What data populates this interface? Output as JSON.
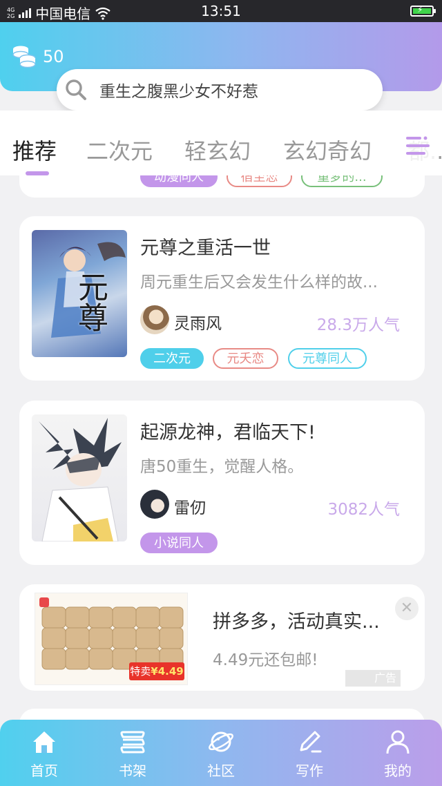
{
  "status_bar": {
    "network": "4G",
    "network2": "2G",
    "carrier": "中国电信",
    "time": "13:51"
  },
  "header": {
    "coin_count": "50",
    "search_placeholder": "重生之腹黑少女不好惹"
  },
  "tabs": [
    {
      "label": "推荐",
      "active": true
    },
    {
      "label": "二次元"
    },
    {
      "label": "轻玄幻"
    },
    {
      "label": "玄幻奇幻"
    },
    {
      "label": "都..."
    }
  ],
  "partial_card": {
    "tags": [
      "动漫同人",
      "宿至恋",
      "童梦的..."
    ]
  },
  "books": [
    {
      "title": "元尊之重活一世",
      "description": "周元重生后又会发生什么样的故...",
      "author": "灵雨风",
      "popularity": "28.3万人气",
      "tags": [
        "二次元",
        "元夭恋",
        "元尊同人"
      ],
      "cover_text": "元尊"
    },
    {
      "title": "起源龙神，君临天下!",
      "description": "唐50重生，觉醒人格。",
      "author": "雷仞",
      "popularity": "3082人气",
      "tags": [
        "小说同人"
      ],
      "cover_text": ""
    }
  ],
  "ad": {
    "title": "拼多多，活动真实...",
    "subtitle": "4.49元还包邮!",
    "badge": "广告",
    "close": "✕",
    "image_price_label": "特卖",
    "image_price": "¥4.49"
  },
  "bottom_nav": [
    {
      "label": "首页",
      "icon": "home-icon"
    },
    {
      "label": "书架",
      "icon": "bookshelf-icon"
    },
    {
      "label": "社区",
      "icon": "planet-icon"
    },
    {
      "label": "写作",
      "icon": "pen-icon"
    },
    {
      "label": "我的",
      "icon": "user-icon"
    }
  ],
  "colors": {
    "accent_purple": "#c396ea",
    "tag_cyan": "#4fcfea",
    "tag_red": "#e88a85",
    "tag_green": "#78c07a",
    "popularity": "#c9a9ea"
  }
}
